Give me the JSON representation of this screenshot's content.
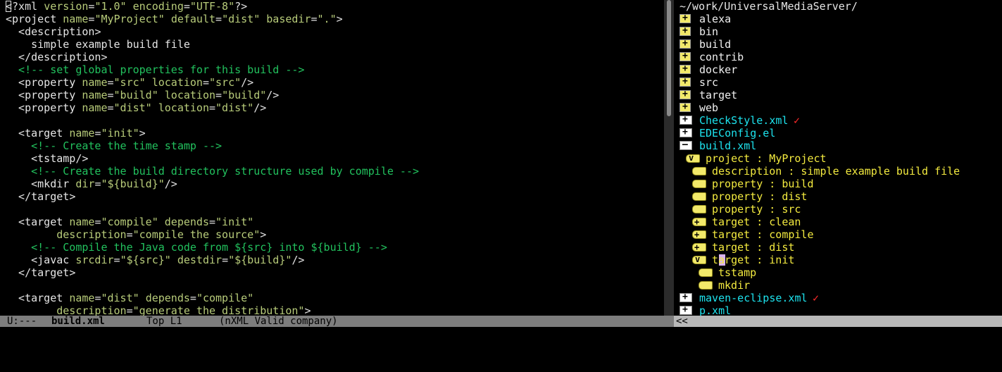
{
  "editor": {
    "lines": [
      [
        [
          "pun",
          "<?xml "
        ],
        [
          "att",
          "version"
        ],
        [
          "pun",
          "="
        ],
        [
          "str",
          "\"1.0\""
        ],
        [
          "pun",
          " "
        ],
        [
          "att",
          "encoding"
        ],
        [
          "pun",
          "="
        ],
        [
          "str",
          "\"UTF-8\""
        ],
        [
          "pun",
          "?>"
        ]
      ],
      [
        [
          "pun",
          "<"
        ],
        [
          "tag",
          "project"
        ],
        [
          "pun",
          " "
        ],
        [
          "att",
          "name"
        ],
        [
          "pun",
          "="
        ],
        [
          "str",
          "\"MyProject\""
        ],
        [
          "pun",
          " "
        ],
        [
          "att",
          "default"
        ],
        [
          "pun",
          "="
        ],
        [
          "str",
          "\"dist\""
        ],
        [
          "pun",
          " "
        ],
        [
          "att",
          "basedir"
        ],
        [
          "pun",
          "="
        ],
        [
          "str",
          "\".\""
        ],
        [
          "pun",
          ">"
        ]
      ],
      [
        [
          "pun",
          "  <"
        ],
        [
          "tag",
          "description"
        ],
        [
          "pun",
          ">"
        ]
      ],
      [
        [
          "txt",
          "    simple example build file"
        ]
      ],
      [
        [
          "pun",
          "  </"
        ],
        [
          "tag",
          "description"
        ],
        [
          "pun",
          ">"
        ]
      ],
      [
        [
          "com",
          "  <!-- set global properties for this build -->"
        ]
      ],
      [
        [
          "pun",
          "  <"
        ],
        [
          "tag",
          "property"
        ],
        [
          "pun",
          " "
        ],
        [
          "att",
          "name"
        ],
        [
          "pun",
          "="
        ],
        [
          "str",
          "\"src\""
        ],
        [
          "pun",
          " "
        ],
        [
          "att",
          "location"
        ],
        [
          "pun",
          "="
        ],
        [
          "str",
          "\"src\""
        ],
        [
          "pun",
          "/>"
        ]
      ],
      [
        [
          "pun",
          "  <"
        ],
        [
          "tag",
          "property"
        ],
        [
          "pun",
          " "
        ],
        [
          "att",
          "name"
        ],
        [
          "pun",
          "="
        ],
        [
          "str",
          "\"build\""
        ],
        [
          "pun",
          " "
        ],
        [
          "att",
          "location"
        ],
        [
          "pun",
          "="
        ],
        [
          "str",
          "\"build\""
        ],
        [
          "pun",
          "/>"
        ]
      ],
      [
        [
          "pun",
          "  <"
        ],
        [
          "tag",
          "property"
        ],
        [
          "pun",
          " "
        ],
        [
          "att",
          "name"
        ],
        [
          "pun",
          "="
        ],
        [
          "str",
          "\"dist\""
        ],
        [
          "pun",
          " "
        ],
        [
          "att",
          "location"
        ],
        [
          "pun",
          "="
        ],
        [
          "str",
          "\"dist\""
        ],
        [
          "pun",
          "/>"
        ]
      ],
      [],
      [
        [
          "pun",
          "  <"
        ],
        [
          "tag",
          "target"
        ],
        [
          "pun",
          " "
        ],
        [
          "att",
          "name"
        ],
        [
          "pun",
          "="
        ],
        [
          "str",
          "\"init\""
        ],
        [
          "pun",
          ">"
        ]
      ],
      [
        [
          "com",
          "    <!-- Create the time stamp -->"
        ]
      ],
      [
        [
          "pun",
          "    <"
        ],
        [
          "tag",
          "tstamp"
        ],
        [
          "pun",
          "/>"
        ]
      ],
      [
        [
          "com",
          "    <!-- Create the build directory structure used by compile -->"
        ]
      ],
      [
        [
          "pun",
          "    <"
        ],
        [
          "tag",
          "mkdir"
        ],
        [
          "pun",
          " "
        ],
        [
          "att",
          "dir"
        ],
        [
          "pun",
          "="
        ],
        [
          "str",
          "\"${build}\""
        ],
        [
          "pun",
          "/>"
        ]
      ],
      [
        [
          "pun",
          "  </"
        ],
        [
          "tag",
          "target"
        ],
        [
          "pun",
          ">"
        ]
      ],
      [],
      [
        [
          "pun",
          "  <"
        ],
        [
          "tag",
          "target"
        ],
        [
          "pun",
          " "
        ],
        [
          "att",
          "name"
        ],
        [
          "pun",
          "="
        ],
        [
          "str",
          "\"compile\""
        ],
        [
          "pun",
          " "
        ],
        [
          "att",
          "depends"
        ],
        [
          "pun",
          "="
        ],
        [
          "str",
          "\"init\""
        ]
      ],
      [
        [
          "pun",
          "        "
        ],
        [
          "att",
          "description"
        ],
        [
          "pun",
          "="
        ],
        [
          "str",
          "\"compile the source\""
        ],
        [
          "pun",
          ">"
        ]
      ],
      [
        [
          "com",
          "    <!-- Compile the Java code from ${src} into ${build} -->"
        ]
      ],
      [
        [
          "pun",
          "    <"
        ],
        [
          "tag",
          "javac"
        ],
        [
          "pun",
          " "
        ],
        [
          "att",
          "srcdir"
        ],
        [
          "pun",
          "="
        ],
        [
          "str",
          "\"${src}\""
        ],
        [
          "pun",
          " "
        ],
        [
          "att",
          "destdir"
        ],
        [
          "pun",
          "="
        ],
        [
          "str",
          "\"${build}\""
        ],
        [
          "pun",
          "/>"
        ]
      ],
      [
        [
          "pun",
          "  </"
        ],
        [
          "tag",
          "target"
        ],
        [
          "pun",
          ">"
        ]
      ],
      [],
      [
        [
          "pun",
          "  <"
        ],
        [
          "tag",
          "target"
        ],
        [
          "pun",
          " "
        ],
        [
          "att",
          "name"
        ],
        [
          "pun",
          "="
        ],
        [
          "str",
          "\"dist\""
        ],
        [
          "pun",
          " "
        ],
        [
          "att",
          "depends"
        ],
        [
          "pun",
          "="
        ],
        [
          "str",
          "\"compile\""
        ]
      ],
      [
        [
          "pun",
          "        "
        ],
        [
          "att",
          "description"
        ],
        [
          "pun",
          "="
        ],
        [
          "str",
          "\"generate the distribution\""
        ],
        [
          "pun",
          ">"
        ]
      ]
    ]
  },
  "tree": {
    "path": "~/work/UniversalMediaServer/",
    "items": [
      {
        "kind": "dir",
        "icon": "folder-icon",
        "label": "alexa",
        "indent": 0
      },
      {
        "kind": "dir",
        "icon": "folder-icon",
        "label": "bin",
        "indent": 0
      },
      {
        "kind": "dir",
        "icon": "folder-icon",
        "label": "build",
        "indent": 0
      },
      {
        "kind": "dir",
        "icon": "folder-icon",
        "label": "contrib",
        "indent": 0
      },
      {
        "kind": "dir",
        "icon": "folder-icon",
        "label": "docker",
        "indent": 0
      },
      {
        "kind": "dir",
        "icon": "folder-icon",
        "label": "src",
        "indent": 0
      },
      {
        "kind": "dir",
        "icon": "folder-icon",
        "label": "target",
        "indent": 0
      },
      {
        "kind": "dir",
        "icon": "folder-icon",
        "label": "web",
        "indent": 0
      },
      {
        "kind": "file",
        "icon": "file-icon",
        "label": "CheckStyle.xml",
        "indent": 0,
        "check": true
      },
      {
        "kind": "file",
        "icon": "file-icon",
        "label": "EDEConfig.el",
        "indent": 0
      },
      {
        "kind": "file",
        "icon": "file-open-icon",
        "label": "build.xml",
        "indent": 0
      },
      {
        "kind": "tag",
        "icon": "tag-open-icon",
        "label": "project : MyProject",
        "indent": 1
      },
      {
        "kind": "tag",
        "icon": "tag-icon",
        "label": "description : simple example build file",
        "indent": 2
      },
      {
        "kind": "tag",
        "icon": "tag-icon",
        "label": "property : build",
        "indent": 2
      },
      {
        "kind": "tag",
        "icon": "tag-icon",
        "label": "property : dist",
        "indent": 2
      },
      {
        "kind": "tag",
        "icon": "tag-icon",
        "label": "property : src",
        "indent": 2
      },
      {
        "kind": "tag",
        "icon": "tag-expand-icon",
        "label": "target : clean",
        "indent": 2
      },
      {
        "kind": "tag",
        "icon": "tag-expand-icon",
        "label": "target : compile",
        "indent": 2
      },
      {
        "kind": "tag",
        "icon": "tag-expand-icon",
        "label": "target : dist",
        "indent": 2
      },
      {
        "kind": "tag",
        "icon": "tag-open-icon",
        "label": "target : init",
        "indent": 2,
        "cursor": true
      },
      {
        "kind": "tag",
        "icon": "tag-icon",
        "label": "tstamp",
        "indent": 3
      },
      {
        "kind": "tag",
        "icon": "tag-icon",
        "label": "mkdir",
        "indent": 3
      },
      {
        "kind": "file",
        "icon": "file-icon",
        "label": "maven-eclipse.xml",
        "indent": 0,
        "check": true
      },
      {
        "kind": "file",
        "icon": "file-icon",
        "label": "p.xml",
        "indent": 0
      }
    ]
  },
  "modeline": {
    "status": "U:---",
    "buffer": "build.xml",
    "position": "Top L1",
    "mode": "(nXML Valid company)"
  },
  "modeline2": {
    "text": "<<"
  }
}
